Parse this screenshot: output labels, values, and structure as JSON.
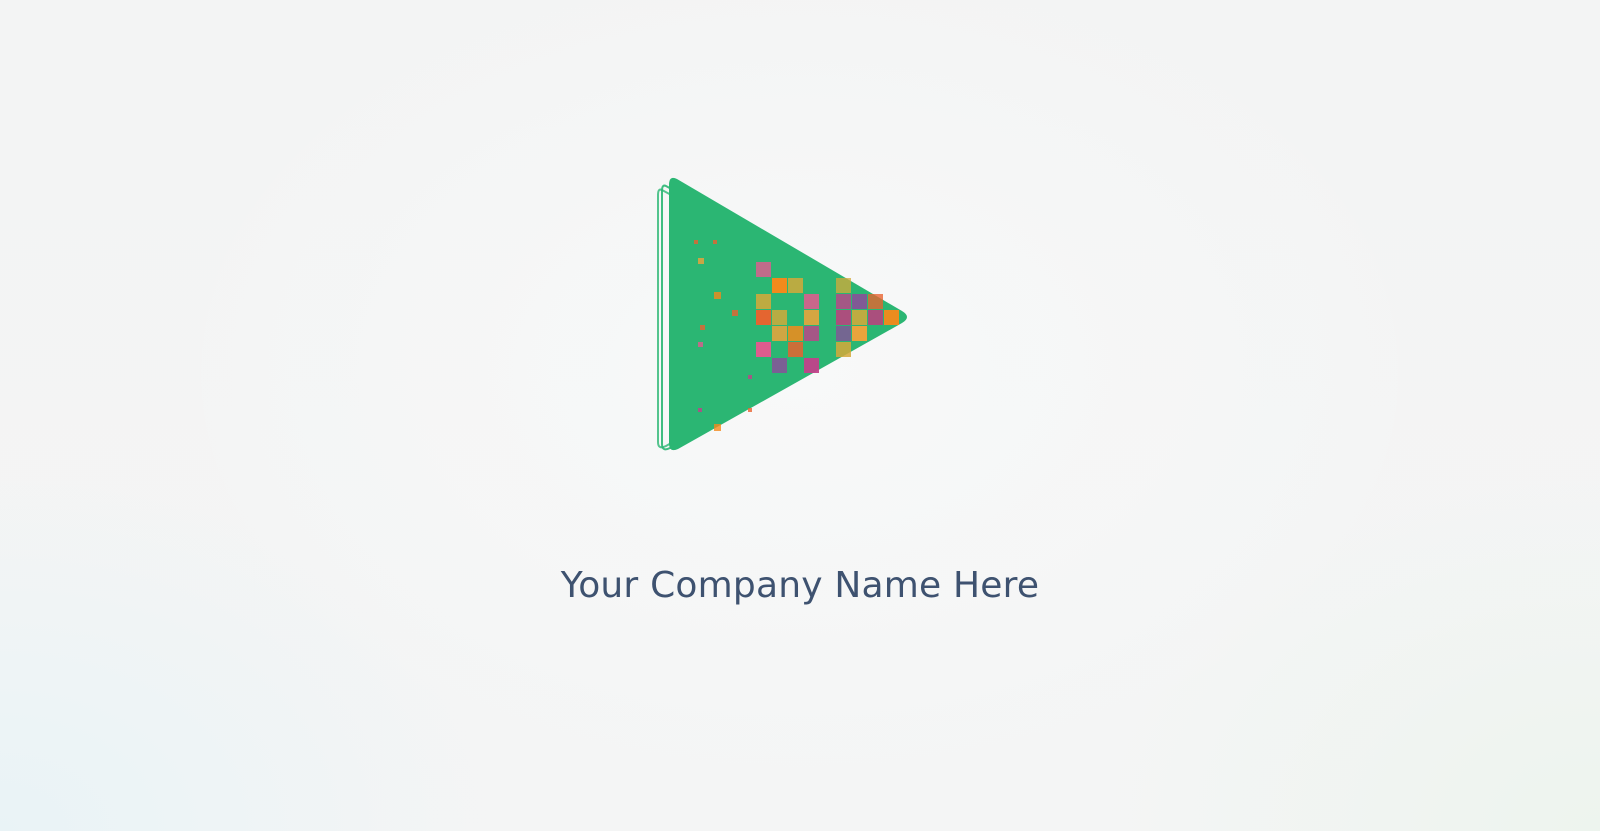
{
  "logo": {
    "icon": "play-triangle-logo-icon",
    "triangle_color": "#2bb673",
    "pixel_palette": [
      "#e8632f",
      "#f28a1c",
      "#c2418a",
      "#e15b8f",
      "#d4a93a",
      "#b5477e",
      "#f0a33a",
      "#8e4b9b"
    ]
  },
  "company": {
    "name": "Your Company Name Here",
    "text_color": "#3e5270"
  }
}
